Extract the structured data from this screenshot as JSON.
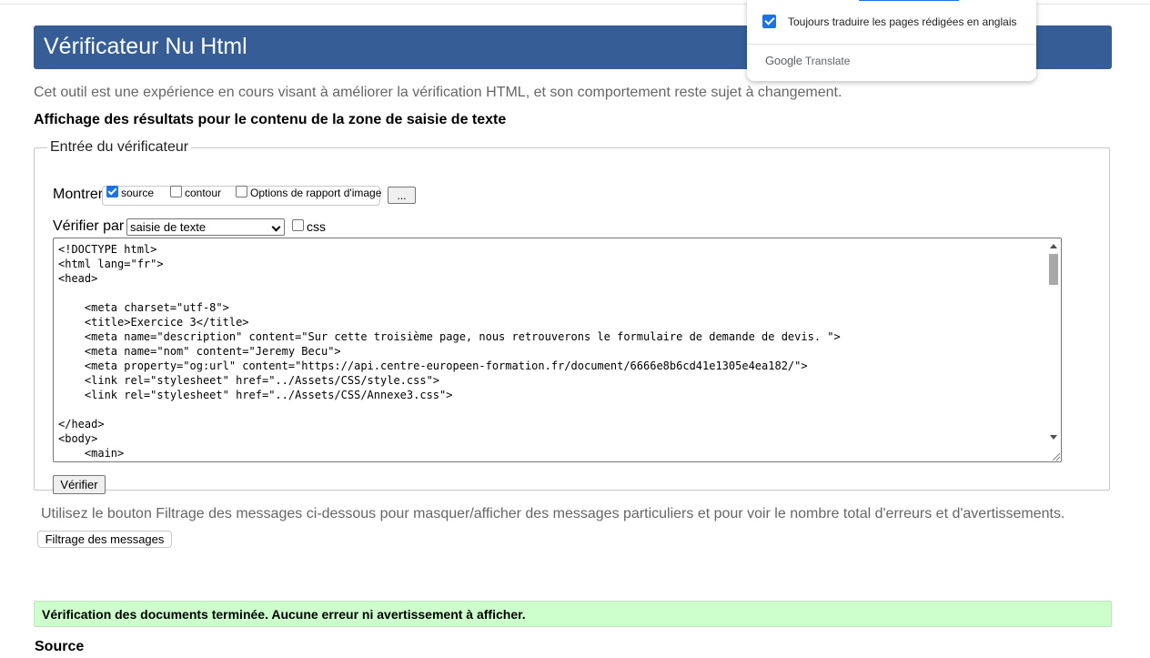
{
  "header": {
    "title": "Vérificateur Nu Html"
  },
  "intro_text": "Cet outil est une expérience en cours visant à améliorer la vérification HTML, et son comportement reste sujet à changement.",
  "results_heading": "Affichage des résultats pour le contenu de la zone de saisie de texte",
  "checker": {
    "legend": "Entrée du vérificateur",
    "show_label": "Montrer",
    "options": [
      {
        "label": "source",
        "checked": true
      },
      {
        "label": "contour",
        "checked": false
      },
      {
        "label": "Options de rapport d'image",
        "checked": false
      }
    ],
    "more_button": "...",
    "verify_by_label": "Vérifier par",
    "verify_by_selected": "saisie de texte",
    "css_label": "css",
    "css_checked": false,
    "source_code": "<!DOCTYPE html>\n<html lang=\"fr\">\n<head>\n\n    <meta charset=\"utf-8\">\n    <title>Exercice 3</title>\n    <meta name=\"description\" content=\"Sur cette troisième page, nous retrouverons le formulaire de demande de devis. \">\n    <meta name=\"nom\" content=\"Jeremy Becu\">\n    <meta property=\"og:url\" content=\"https://api.centre-europeen-formation.fr/document/6666e8b6cd41e1305e4ea182/\">\n    <link rel=\"stylesheet\" href=\"../Assets/CSS/style.css\">\n    <link rel=\"stylesheet\" href=\"../Assets/CSS/Annexe3.css\">\n\n</head>\n<body>\n    <main>",
    "verify_button": "Vérifier"
  },
  "filter_note": "Utilisez le bouton Filtrage des messages ci-dessous pour masquer/afficher des messages particuliers et pour voir le nombre total d'erreurs et d'avertissements.",
  "filter_button": "Filtrage des messages",
  "success_message": "Vérification des documents terminée. Aucune erreur ni avertissement à afficher.",
  "source_heading": "Source",
  "translate_popup": {
    "always_translate_label": "Toujours traduire les pages rédigées en anglais",
    "always_translate_checked": true,
    "brand_google": "Google",
    "brand_translate": "Translate"
  },
  "colors": {
    "header_bg": "#365d95",
    "success_bg": "#ccffcc",
    "accent": "#1a73e8"
  }
}
